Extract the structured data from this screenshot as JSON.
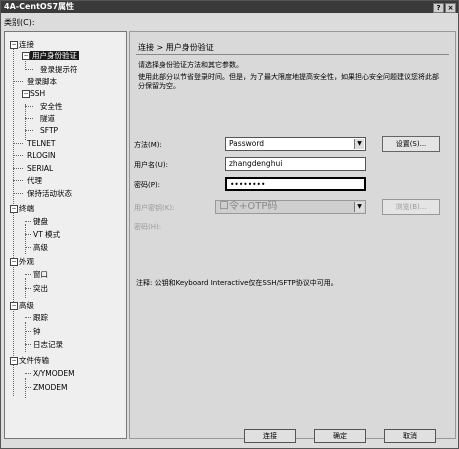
{
  "window": {
    "title": "4A-CentOS7属性",
    "category_label": "类别(C):",
    "close_glyph": "×",
    "help_glyph": "?"
  },
  "tree": {
    "nodes": [
      {
        "label": "连接"
      },
      {
        "label": "用户身份验证"
      },
      {
        "label": "登录提示符"
      },
      {
        "label": "登录脚本"
      },
      {
        "label": "SSH"
      },
      {
        "label": "安全性"
      },
      {
        "label": "隧道"
      },
      {
        "label": "SFTP"
      },
      {
        "label": "TELNET"
      },
      {
        "label": "RLOGIN"
      },
      {
        "label": "SERIAL"
      },
      {
        "label": "代理"
      },
      {
        "label": "保持活动状态"
      },
      {
        "label": "终端"
      },
      {
        "label": "键盘"
      },
      {
        "label": "VT 模式"
      },
      {
        "label": "高级"
      },
      {
        "label": "外观"
      },
      {
        "label": "窗口"
      },
      {
        "label": "突出"
      },
      {
        "label": "高级"
      },
      {
        "label": "跟踪"
      },
      {
        "label": "钟"
      },
      {
        "label": "日志记录"
      },
      {
        "label": "文件传输"
      },
      {
        "label": "X/YMODEM"
      },
      {
        "label": "ZMODEM"
      }
    ],
    "expander_minus": "−"
  },
  "panel": {
    "breadcrumb": "连接 > 用户身份验证",
    "desc1": "请选择身份验证方法和其它参数。",
    "desc2": "使用此部分以节省登录时间。但是，为了最大限度地提高安全性，如果担心安全问题建议您将此部分保留为空。",
    "method_label": "方法(M):",
    "method_value": "Password",
    "settings_button": "设置(S)...",
    "username_label": "用户名(U):",
    "username_value": "zhangdenghui",
    "password_label": "密码(P):",
    "password_value": "••••••••",
    "userkey_label": "用户密钥(K):",
    "userkey_value": "口令+OTP码",
    "browse_button": "浏览(B)...",
    "passphrase_label": "密码(H):",
    "note": "注释: 公钥和Keyboard Interactive仅在SSH/SFTP协议中可用。",
    "dropdown_arrow": "▼"
  },
  "footer": {
    "connect": "连接",
    "ok": "确定",
    "cancel": "取消"
  }
}
